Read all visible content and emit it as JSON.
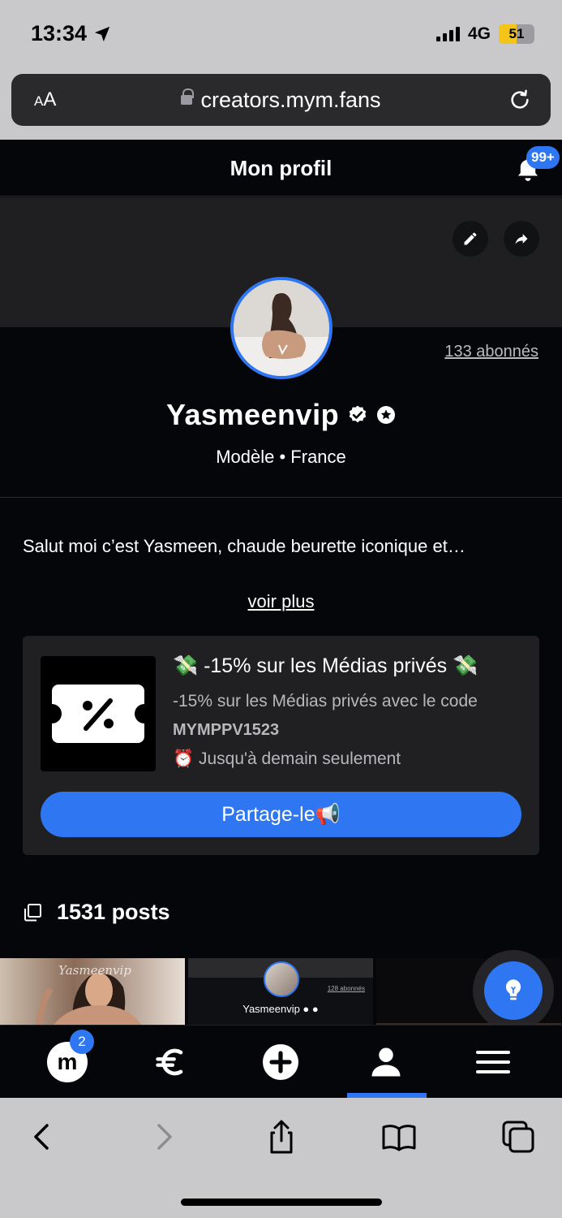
{
  "status_bar": {
    "time": "13:34",
    "network": "4G",
    "battery": "51"
  },
  "browser": {
    "text_size_label": "AA",
    "url": "creators.mym.fans"
  },
  "header": {
    "title": "Mon profil",
    "notifications_badge": "99+"
  },
  "profile": {
    "subscribers": "133 abonnés",
    "username": "Yasmeenvip",
    "meta": "Modèle • France",
    "bio": "Salut moi c’est Yasmeen, chaude beurette iconique et…",
    "see_more": "voir plus"
  },
  "promo": {
    "title": "💸 -15% sur les Médias privés 💸",
    "description": "-15% sur les Médias privés avec le code",
    "code": "MYMPPV1523",
    "deadline": "⏰ Jusqu'à demain seulement",
    "share_label": "Partage-le📢"
  },
  "posts": {
    "count_label": "1531 posts"
  },
  "thumbnail_preview": {
    "username": "Yasmeenvip",
    "subscribers": "128 abonnés",
    "watermark": "Yasmeenvip"
  },
  "bottom_nav": {
    "logo_letter": "m",
    "messages_badge": "2",
    "items": [
      "home",
      "earnings",
      "create",
      "profile",
      "menu"
    ],
    "active": "profile"
  },
  "colors": {
    "accent": "#2f76f2",
    "background": "#05060a",
    "card": "#202022"
  }
}
